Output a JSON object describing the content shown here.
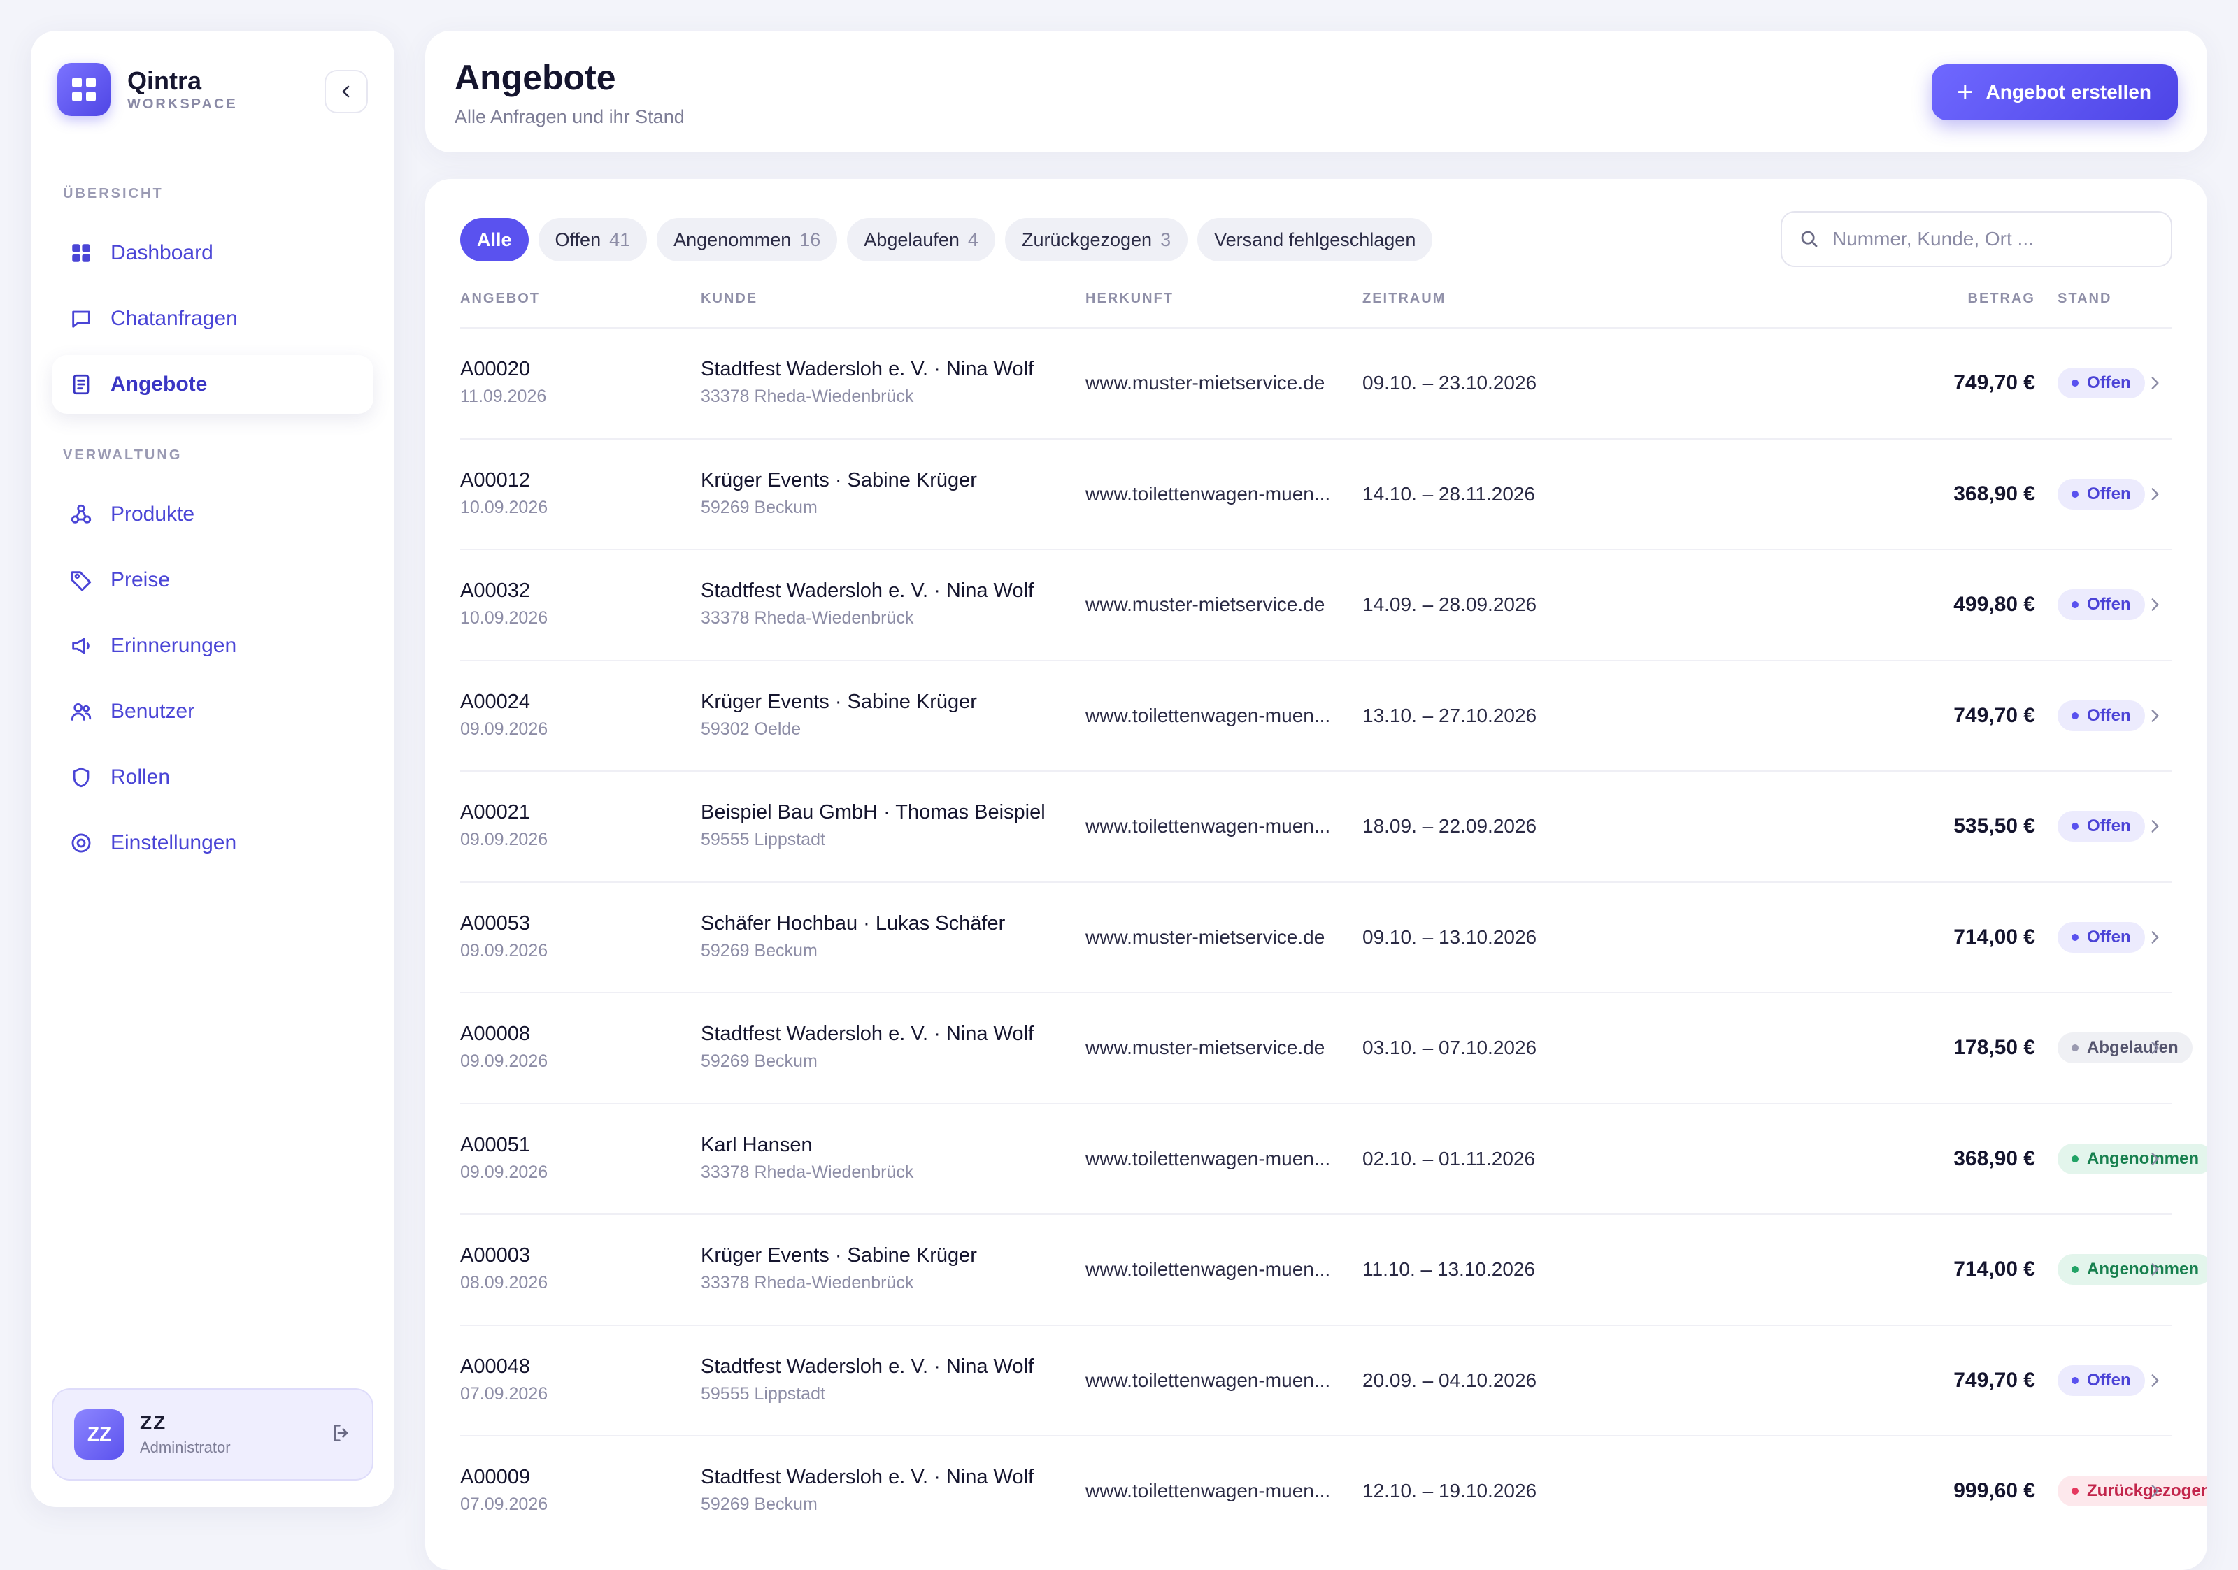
{
  "sidebar": {
    "brand_name": "Qintra",
    "brand_sub": "WORKSPACE",
    "section_overview": "ÜBERSICHT",
    "section_admin": "VERWALTUNG",
    "items": [
      {
        "label": "Dashboard",
        "icon": "grid-icon"
      },
      {
        "label": "Chatanfragen",
        "icon": "chat-icon"
      },
      {
        "label": "Angebote",
        "icon": "document-icon"
      },
      {
        "label": "Produkte",
        "icon": "products-icon"
      },
      {
        "label": "Preise",
        "icon": "tag-icon"
      },
      {
        "label": "Erinnerungen",
        "icon": "megaphone-icon"
      },
      {
        "label": "Benutzer",
        "icon": "users-icon"
      },
      {
        "label": "Rollen",
        "icon": "shield-icon"
      },
      {
        "label": "Einstellungen",
        "icon": "settings-icon"
      }
    ],
    "user": {
      "initials": "ZZ",
      "name": "ZZ",
      "role": "Administrator"
    }
  },
  "header": {
    "title": "Angebote",
    "subtitle": "Alle Anfragen und ihr Stand",
    "create_label": "Angebot erstellen"
  },
  "filters": [
    {
      "label": "Alle",
      "count": ""
    },
    {
      "label": "Offen",
      "count": "41"
    },
    {
      "label": "Angenommen",
      "count": "16"
    },
    {
      "label": "Abgelaufen",
      "count": "4"
    },
    {
      "label": "Zurückgezogen",
      "count": "3"
    },
    {
      "label": "Versand fehlgeschlagen",
      "count": ""
    }
  ],
  "search": {
    "placeholder": "Nummer, Kunde, Ort ..."
  },
  "table": {
    "columns": [
      "ANGEBOT",
      "KUNDE",
      "HERKUNFT",
      "ZEITRAUM",
      "BETRAG",
      "STAND"
    ],
    "rows": [
      {
        "id": "A00020",
        "date": "11.09.2026",
        "kunde": "Stadtfest Wadersloh e. V. · Nina Wolf",
        "ort": "33378 Rheda-Wiedenbrück",
        "herkunft": "www.muster-mietservice.de",
        "zeitraum": "09.10. – 23.10.2026",
        "betrag": "749,70 €",
        "stand": "Offen"
      },
      {
        "id": "A00012",
        "date": "10.09.2026",
        "kunde": "Krüger Events · Sabine Krüger",
        "ort": "59269 Beckum",
        "herkunft": "www.toilettenwagen-muen...",
        "zeitraum": "14.10. – 28.11.2026",
        "betrag": "368,90 €",
        "stand": "Offen"
      },
      {
        "id": "A00032",
        "date": "10.09.2026",
        "kunde": "Stadtfest Wadersloh e. V. · Nina Wolf",
        "ort": "33378 Rheda-Wiedenbrück",
        "herkunft": "www.muster-mietservice.de",
        "zeitraum": "14.09. – 28.09.2026",
        "betrag": "499,80 €",
        "stand": "Offen"
      },
      {
        "id": "A00024",
        "date": "09.09.2026",
        "kunde": "Krüger Events · Sabine Krüger",
        "ort": "59302 Oelde",
        "herkunft": "www.toilettenwagen-muen...",
        "zeitraum": "13.10. – 27.10.2026",
        "betrag": "749,70 €",
        "stand": "Offen"
      },
      {
        "id": "A00021",
        "date": "09.09.2026",
        "kunde": "Beispiel Bau GmbH · Thomas Beispiel",
        "ort": "59555 Lippstadt",
        "herkunft": "www.toilettenwagen-muen...",
        "zeitraum": "18.09. – 22.09.2026",
        "betrag": "535,50 €",
        "stand": "Offen"
      },
      {
        "id": "A00053",
        "date": "09.09.2026",
        "kunde": "Schäfer Hochbau · Lukas Schäfer",
        "ort": "59269 Beckum",
        "herkunft": "www.muster-mietservice.de",
        "zeitraum": "09.10. – 13.10.2026",
        "betrag": "714,00 €",
        "stand": "Offen"
      },
      {
        "id": "A00008",
        "date": "09.09.2026",
        "kunde": "Stadtfest Wadersloh e. V. · Nina Wolf",
        "ort": "59269 Beckum",
        "herkunft": "www.muster-mietservice.de",
        "zeitraum": "03.10. – 07.10.2026",
        "betrag": "178,50 €",
        "stand": "Abgelaufen"
      },
      {
        "id": "A00051",
        "date": "09.09.2026",
        "kunde": "Karl Hansen",
        "ort": "33378 Rheda-Wiedenbrück",
        "herkunft": "www.toilettenwagen-muen...",
        "zeitraum": "02.10. – 01.11.2026",
        "betrag": "368,90 €",
        "stand": "Angenommen"
      },
      {
        "id": "A00003",
        "date": "08.09.2026",
        "kunde": "Krüger Events · Sabine Krüger",
        "ort": "33378 Rheda-Wiedenbrück",
        "herkunft": "www.toilettenwagen-muen...",
        "zeitraum": "11.10. – 13.10.2026",
        "betrag": "714,00 €",
        "stand": "Angenommen"
      },
      {
        "id": "A00048",
        "date": "07.09.2026",
        "kunde": "Stadtfest Wadersloh e. V. · Nina Wolf",
        "ort": "59555 Lippstadt",
        "herkunft": "www.toilettenwagen-muen...",
        "zeitraum": "20.09. – 04.10.2026",
        "betrag": "749,70 €",
        "stand": "Offen"
      },
      {
        "id": "A00009",
        "date": "07.09.2026",
        "kunde": "Stadtfest Wadersloh e. V. · Nina Wolf",
        "ort": "59269 Beckum",
        "herkunft": "www.toilettenwagen-muen...",
        "zeitraum": "12.10. – 19.10.2026",
        "betrag": "999,60 €",
        "stand": "Zurückgezogen"
      }
    ]
  },
  "colors": {
    "accent": "#5a52ef",
    "offen": "#4b43d6",
    "angenommen": "#18804f",
    "abgelaufen": "#55556e",
    "zurueckgezogen": "#c2254b"
  }
}
